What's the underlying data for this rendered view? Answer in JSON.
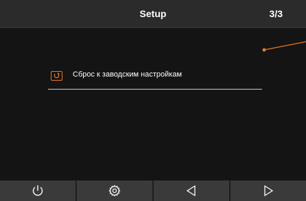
{
  "header": {
    "title": "Setup",
    "page_indicator": "3/3"
  },
  "menu": {
    "items": [
      {
        "label": "Сброс к заводским настройкам",
        "icon": "reset-icon"
      }
    ]
  },
  "bottom_bar": {
    "buttons": [
      {
        "icon": "power-icon"
      },
      {
        "icon": "gear-icon"
      },
      {
        "icon": "triangle-left-icon"
      },
      {
        "icon": "triangle-right-icon"
      }
    ]
  },
  "colors": {
    "accent": "#f07a1a",
    "header_bg": "#2b2b2b",
    "content_bg": "#141414",
    "button_bg": "#3a3a3a",
    "text": "#ffffff"
  }
}
